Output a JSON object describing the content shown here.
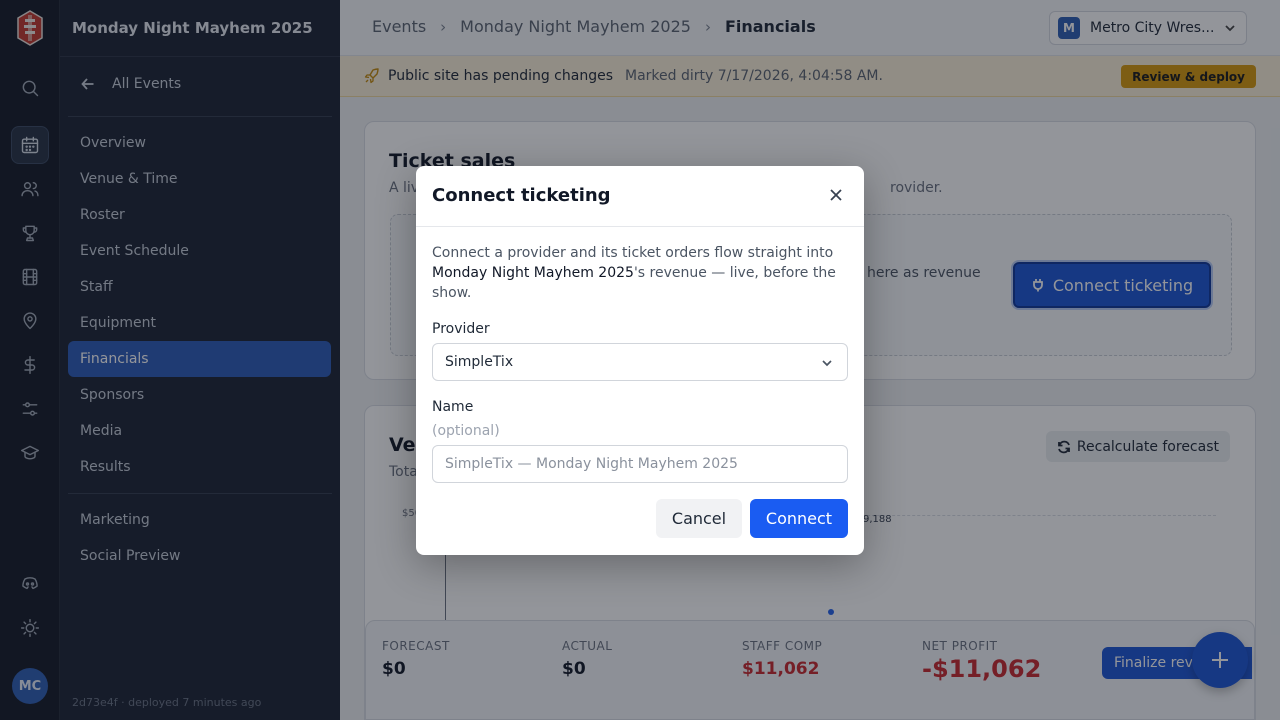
{
  "rail": {
    "avatar_initials": "MC"
  },
  "sidenav": {
    "event_title": "Monday Night Mayhem 2025",
    "back_label": "All Events",
    "items": [
      {
        "label": "Overview"
      },
      {
        "label": "Venue & Time"
      },
      {
        "label": "Roster"
      },
      {
        "label": "Event Schedule"
      },
      {
        "label": "Staff"
      },
      {
        "label": "Equipment"
      },
      {
        "label": "Financials",
        "active": true
      },
      {
        "label": "Sponsors"
      },
      {
        "label": "Media"
      },
      {
        "label": "Results"
      }
    ],
    "secondary_items": [
      {
        "label": "Marketing"
      },
      {
        "label": "Social Preview"
      }
    ],
    "footer": "2d73e4f · deployed 7 minutes ago"
  },
  "topbar": {
    "breadcrumbs": [
      "Events",
      "Monday Night Mayhem 2025",
      "Financials"
    ],
    "org_badge": "M",
    "org_name": "Metro City Wres..."
  },
  "banner": {
    "title": "Public site has pending changes",
    "meta": "Marked dirty 7/17/2026, 4:04:58 AM.",
    "action": "Review & deploy"
  },
  "ticket_card": {
    "title": "Ticket sales",
    "subtitle_start": "A liv",
    "subtitle_end": "rovider.",
    "body_fragment": "here as revenue",
    "connect_label": "Connect ticketing"
  },
  "revenue_card": {
    "title_fragment": "Ve",
    "subtitle_fragment": "Tota",
    "recalc_label": "Recalculate forecast",
    "ytick": "$50",
    "point_label": "9,188"
  },
  "summary": {
    "forecast_label": "FORECAST",
    "forecast_value": "$0",
    "actual_label": "ACTUAL",
    "actual_value": "$0",
    "staff_comp_label": "STAFF COMP",
    "staff_comp_value": "$11,062",
    "net_profit_label": "NET PROFIT",
    "net_profit_value": "-$11,062",
    "finalize_label": "Finalize rev"
  },
  "modal": {
    "title": "Connect ticketing",
    "desc_before": "Connect a provider and its ticket orders flow straight into ",
    "desc_event": "Monday Night Mayhem 2025",
    "desc_after": "'s revenue — live, before the show.",
    "provider_label": "Provider",
    "provider_value": "SimpleTix",
    "name_label": "Name",
    "name_hint": "(optional)",
    "name_placeholder": "SimpleTix — Monday Night Mayhem 2025",
    "name_value": "",
    "cancel_label": "Cancel",
    "connect_label": "Connect"
  },
  "colors": {
    "primary": "#1d56d6",
    "sidebar_bg": "#1d2433",
    "rail_bg": "#151b27",
    "banner_bg": "#fbf0d9",
    "warning": "#d89a0c",
    "negative": "#c8292f"
  }
}
